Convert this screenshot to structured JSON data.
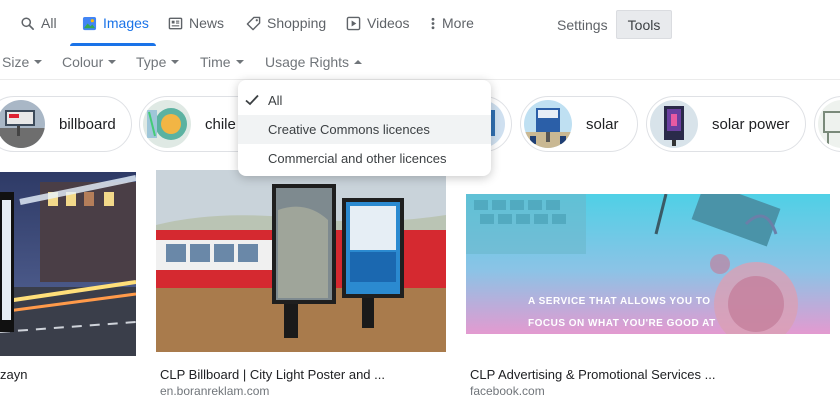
{
  "nav": {
    "tabs": [
      {
        "label": "All",
        "icon": "search-icon"
      },
      {
        "label": "Images",
        "icon": "images-icon",
        "active": true
      },
      {
        "label": "News",
        "icon": "news-icon"
      },
      {
        "label": "Shopping",
        "icon": "tag-icon"
      },
      {
        "label": "Videos",
        "icon": "play-icon"
      },
      {
        "label": "More",
        "icon": "more-dots-icon"
      }
    ],
    "settings_label": "Settings",
    "tools_label": "Tools"
  },
  "filters": [
    "Size",
    "Colour",
    "Type",
    "Time",
    "Usage Rights"
  ],
  "chips": [
    {
      "label": "billboard"
    },
    {
      "label": "chile"
    },
    {
      "label": "solar"
    },
    {
      "label": "solar power"
    }
  ],
  "usage_rights_menu": {
    "items": [
      {
        "label": "All",
        "selected": true
      },
      {
        "label": "Creative Commons licences",
        "highlighted": true
      },
      {
        "label": "Commercial and other licences"
      }
    ]
  },
  "results": [
    {
      "title": "zayn",
      "source": ""
    },
    {
      "title": "CLP Billboard | City Light Poster and ...",
      "source": "en.boranreklam.com"
    },
    {
      "title": "CLP Advertising & Promotional Services ...",
      "source": "facebook.com",
      "image_text": [
        "A SERVICE THAT ALLOWS YOU TO",
        "FOCUS ON WHAT YOU'RE GOOD AT"
      ]
    }
  ],
  "colors": {
    "accent": "#1a73e8",
    "muted": "#70757a"
  }
}
